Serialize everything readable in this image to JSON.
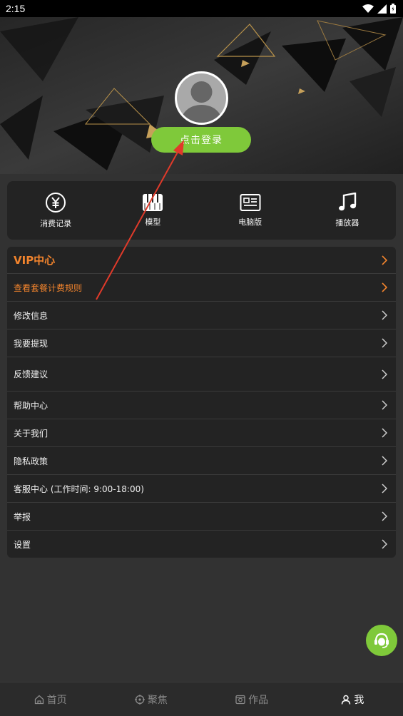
{
  "status_bar": {
    "time": "2:15",
    "icons": [
      "wifi-icon",
      "signal-icon",
      "battery-icon"
    ]
  },
  "header": {
    "avatar_icon": "default-avatar-icon",
    "login_label": "点击登录"
  },
  "quick_actions": [
    {
      "label": "消费记录",
      "icon": "yen-circle-icon"
    },
    {
      "label": "模型",
      "icon": "piano-icon"
    },
    {
      "label": "电脑版",
      "icon": "computer-card-icon"
    },
    {
      "label": "播放器",
      "icon": "music-note-icon"
    }
  ],
  "menu": {
    "vip_title": "VIP中心",
    "items": [
      "查看套餐计费规则",
      "修改信息",
      "我要提现",
      "反馈建议",
      "帮助中心",
      "关于我们",
      "隐私政策",
      "客服中心 (工作时间: 9:00-18:00)",
      "举报",
      "设置"
    ]
  },
  "support_icon": "customer-service-icon",
  "bottom_nav": [
    {
      "label": "首页",
      "icon": "home-icon",
      "active": false
    },
    {
      "label": "聚焦",
      "icon": "focus-icon",
      "active": false
    },
    {
      "label": "作品",
      "icon": "works-icon",
      "active": false
    },
    {
      "label": "我",
      "icon": "user-icon",
      "active": true
    }
  ],
  "colors": {
    "accent_green": "#7fc93a",
    "vip_orange": "#f2842d",
    "annotation_red": "#e03a2a"
  }
}
